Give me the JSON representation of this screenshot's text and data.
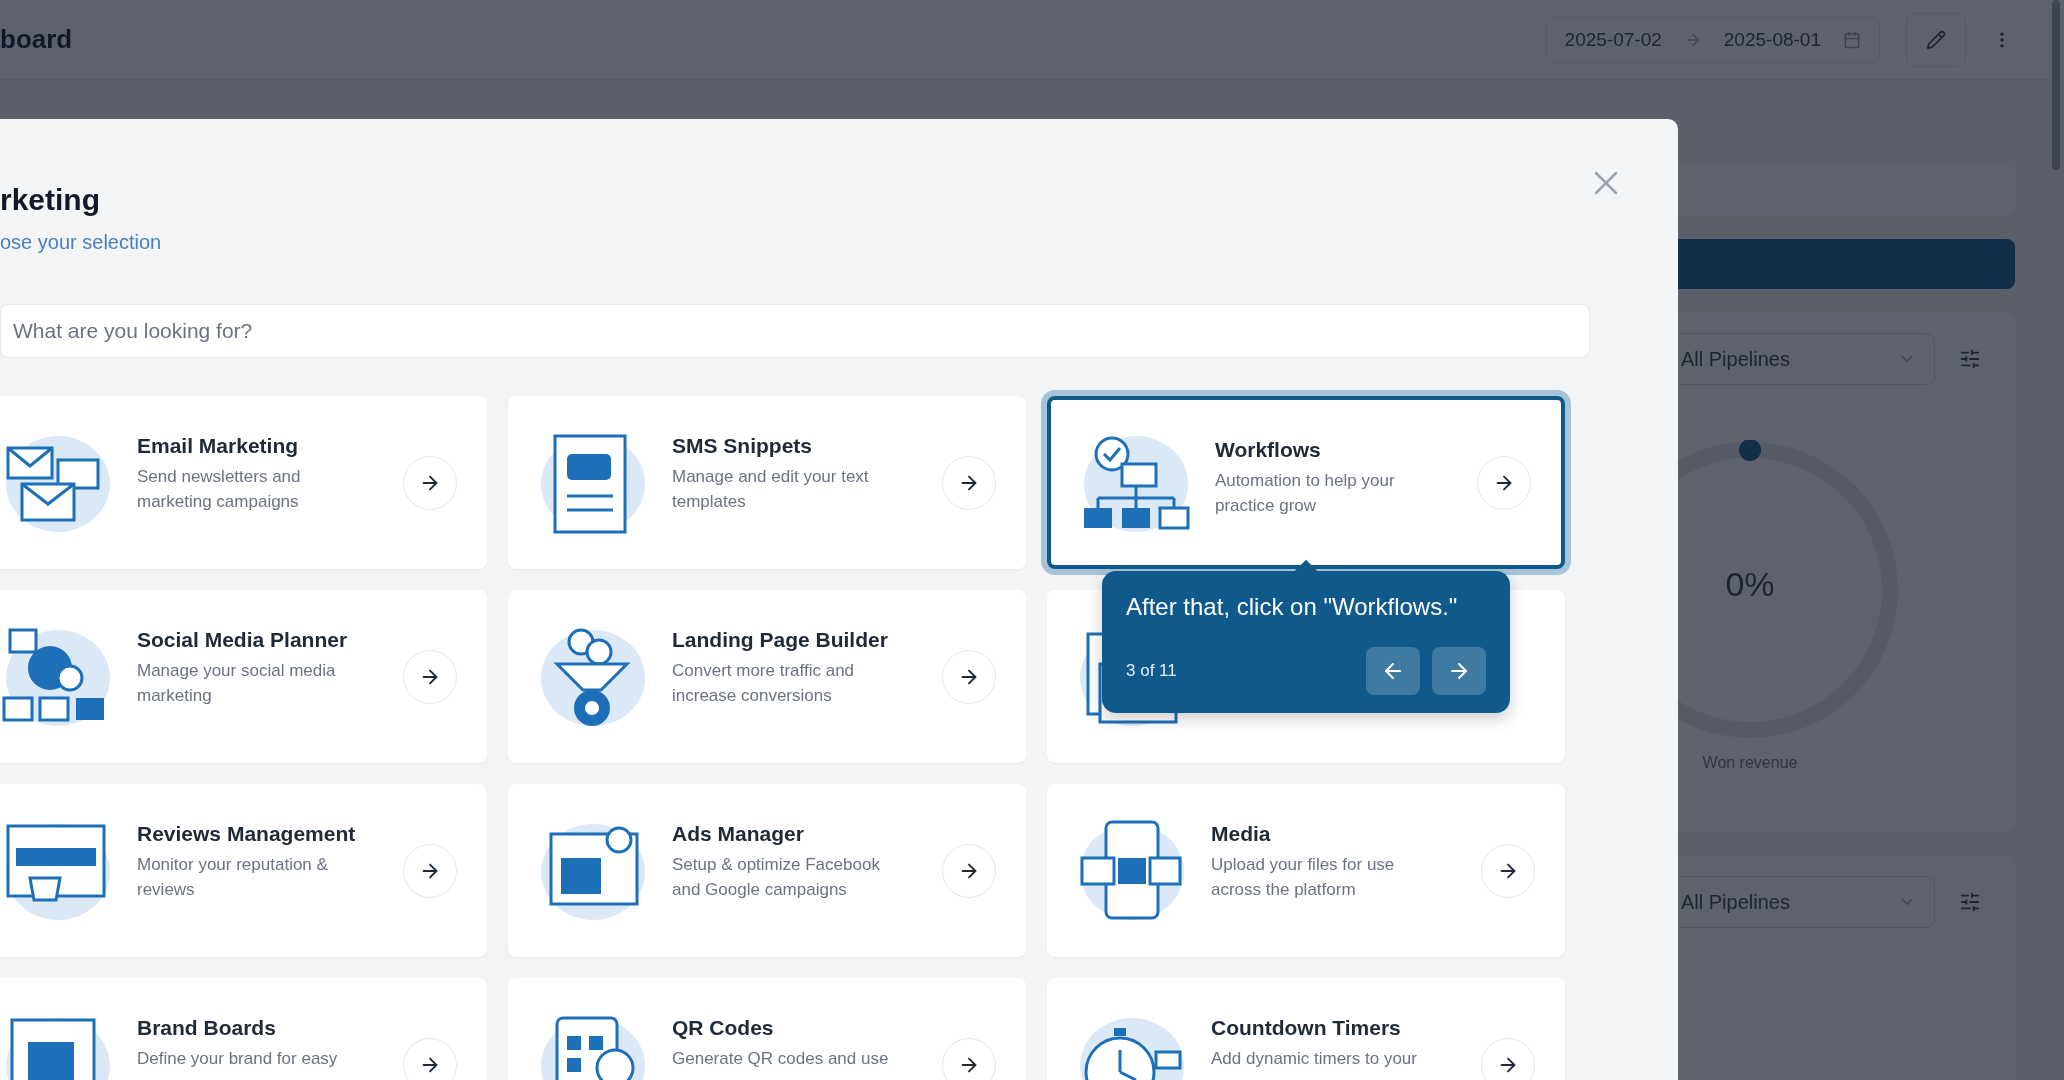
{
  "dashboard": {
    "title": "board",
    "date_range": {
      "start": "2025-07-02",
      "end": "2025-08-01"
    },
    "widgets": [
      {
        "select": "All Pipelines",
        "gauge": {
          "value": "0%",
          "caption": "Won revenue"
        }
      },
      {
        "select": "All Pipelines"
      }
    ]
  },
  "modal": {
    "title": "rketing",
    "subtitle": "ose your selection",
    "search": {
      "placeholder": "What are you looking for?"
    },
    "cards": [
      {
        "kind": "email",
        "title": "Email Marketing",
        "description": "Send newsletters and marketing campaigns",
        "highlighted": false
      },
      {
        "kind": "sms",
        "title": "SMS Snippets",
        "description": "Manage and edit your text templates",
        "highlighted": false
      },
      {
        "kind": "workflow",
        "title": "Workflows",
        "description": "Automation to help your practice grow",
        "highlighted": true
      },
      {
        "kind": "social",
        "title": "Social Media Planner",
        "description": "Manage your social media marketing",
        "highlighted": false
      },
      {
        "kind": "funnel",
        "title": "Landing Page Builder",
        "description": "Convert more traffic and increase conversions",
        "highlighted": false
      },
      {
        "kind": "devices",
        "highlighted": false
      },
      {
        "kind": "reviews",
        "title": "Reviews Management",
        "description": "Monitor your reputation & reviews",
        "highlighted": false
      },
      {
        "kind": "ads",
        "title": "Ads Manager",
        "description": "Setup & optimize Facebook and Google campaigns",
        "highlighted": false
      },
      {
        "kind": "media",
        "title": "Media",
        "description": "Upload your files for use across the platform",
        "highlighted": false
      },
      {
        "kind": "brand",
        "title": "Brand Boards",
        "description": "Define your brand for easy",
        "highlighted": false
      },
      {
        "kind": "qr",
        "title": "QR Codes",
        "description": "Generate QR codes and use",
        "highlighted": false
      },
      {
        "kind": "timer",
        "title": "Countdown Timers",
        "description": "Add dynamic timers to your",
        "highlighted": false
      }
    ]
  },
  "tour_tooltip": {
    "text": "After that, click on \"Workflows.\"",
    "step": "3 of 11"
  }
}
